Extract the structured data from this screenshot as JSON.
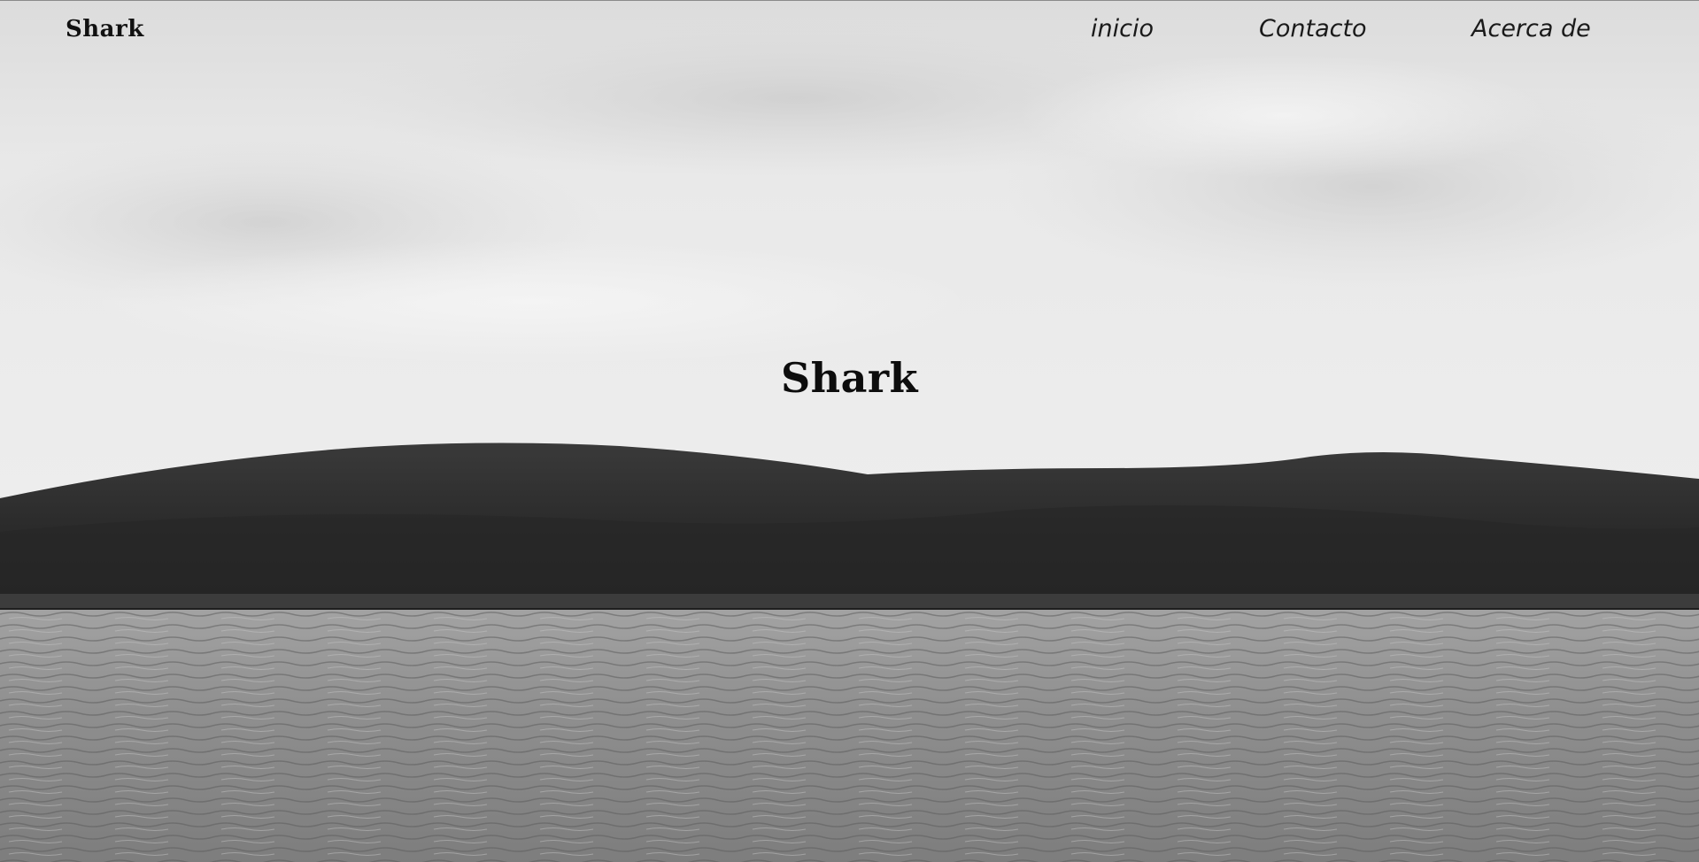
{
  "site": {
    "brand": "Shark"
  },
  "nav": {
    "items": [
      {
        "label": "inicio"
      },
      {
        "label": "Contacto"
      },
      {
        "label": "Acerca de"
      }
    ]
  },
  "hero": {
    "title": "Shark",
    "background_icon": "landscape-photo-icon"
  },
  "colors": {
    "sky": "#e4e4e4",
    "hills": "#2e2e2e",
    "water": "#8c8c8c",
    "text": "#111111"
  }
}
